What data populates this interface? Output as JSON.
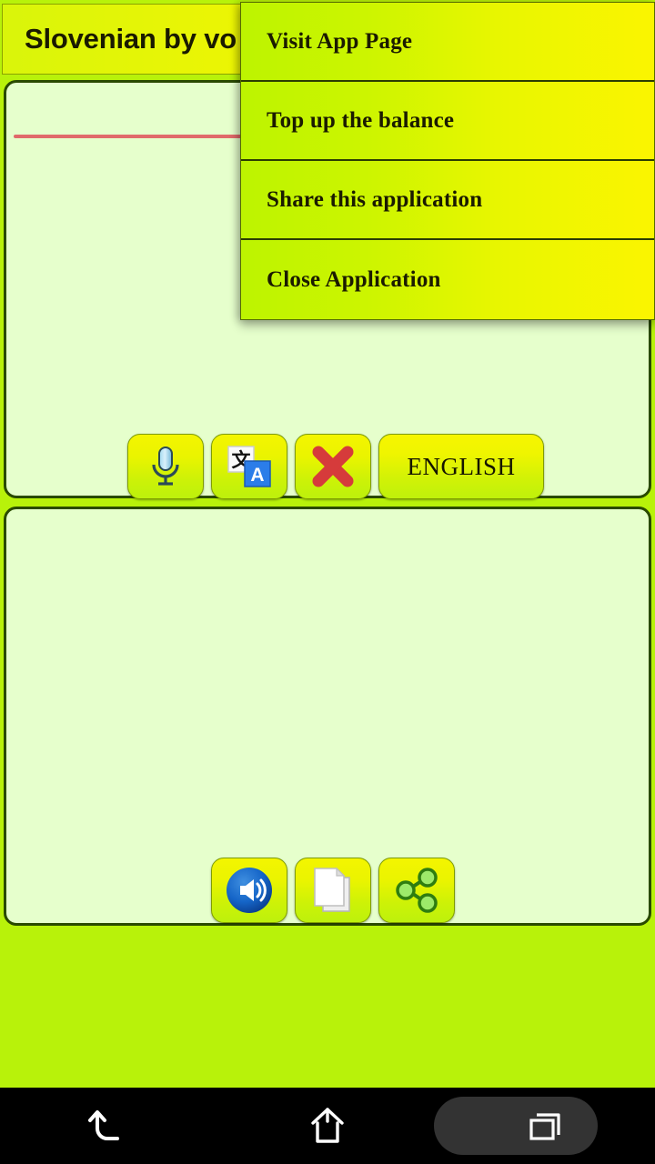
{
  "app": {
    "title": "Slovenian by vo",
    "background_color": "#b8f20a",
    "panel_color": "#e6ffcc",
    "accent_yellow": "#f7f500"
  },
  "popup_menu": {
    "items": [
      {
        "label": "Visit App Page",
        "icon": "link-icon"
      },
      {
        "label": "Top up the balance",
        "icon": "wallet-icon"
      },
      {
        "label": "Share this application",
        "icon": "share-icon"
      },
      {
        "label": "Close Application",
        "icon": "power-icon"
      }
    ]
  },
  "input_panel": {
    "text_value": "",
    "underline_color": "#e06a6a",
    "buttons": [
      {
        "name": "microphone-button",
        "icon": "microphone-icon",
        "label": ""
      },
      {
        "name": "translate-button",
        "icon": "translate-icon",
        "label": ""
      },
      {
        "name": "clear-button",
        "icon": "close-x-icon",
        "label": ""
      },
      {
        "name": "language-button",
        "icon": "language-icon",
        "label": "ENGLISH"
      }
    ]
  },
  "output_panel": {
    "text_value": "",
    "buttons": [
      {
        "name": "speak-button",
        "icon": "speaker-icon",
        "label": ""
      },
      {
        "name": "copy-button",
        "icon": "copy-icon",
        "label": ""
      },
      {
        "name": "share-button",
        "icon": "share-nodes-icon",
        "label": ""
      }
    ]
  },
  "nav_bar": {
    "buttons": [
      {
        "name": "back-button",
        "icon": "back-arrow-icon",
        "label": ""
      },
      {
        "name": "home-button",
        "icon": "home-icon",
        "label": ""
      },
      {
        "name": "recents-button",
        "icon": "recents-icon",
        "label": ""
      }
    ]
  }
}
